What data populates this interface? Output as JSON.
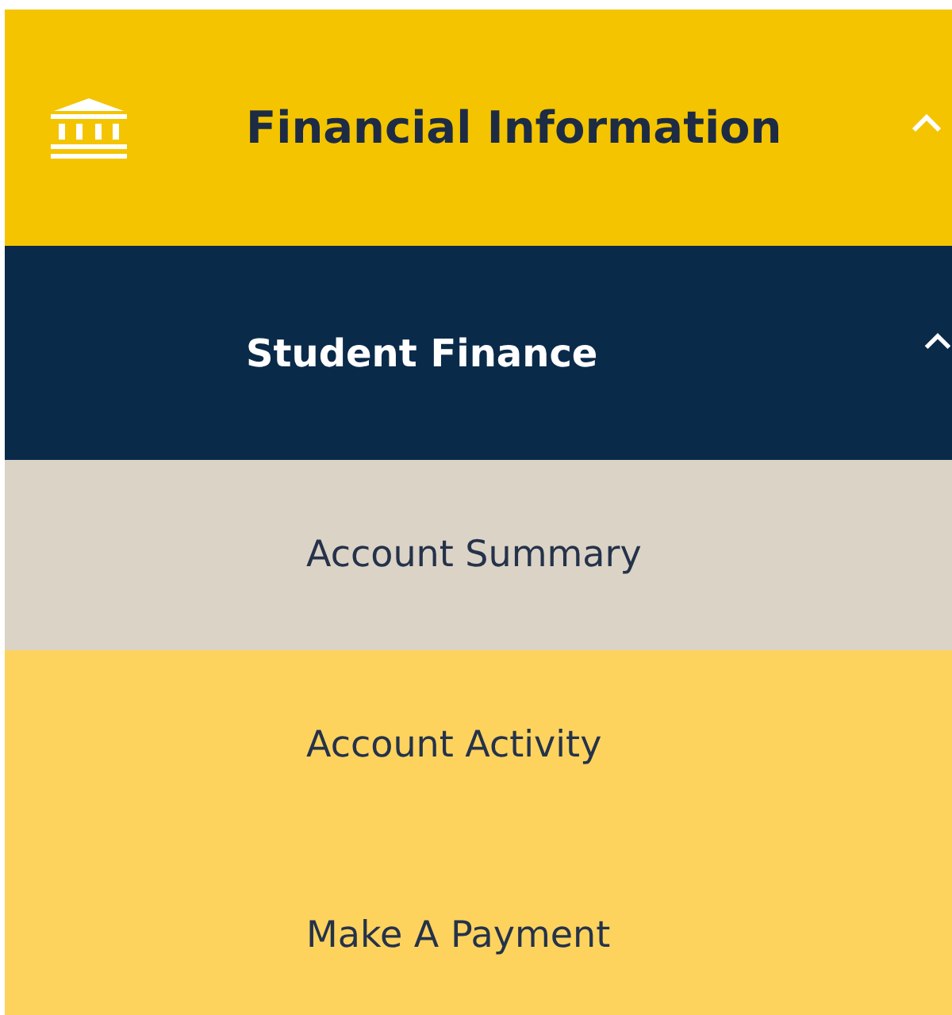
{
  "menu": {
    "title": "Financial Information",
    "expanded": true,
    "section": {
      "title": "Student Finance",
      "expanded": true,
      "items": [
        {
          "label": "Account Summary",
          "selected": true
        },
        {
          "label": "Account Activity",
          "selected": false
        },
        {
          "label": "Make A Payment",
          "selected": false
        }
      ]
    }
  }
}
